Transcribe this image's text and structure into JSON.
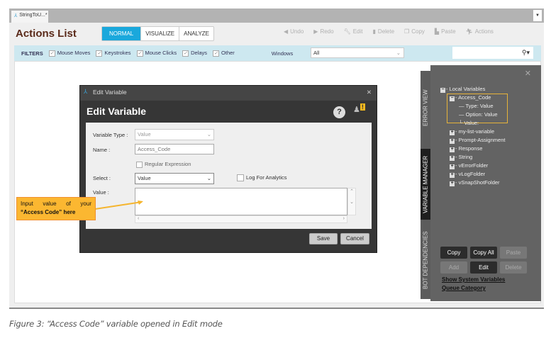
{
  "window": {
    "tab_title": "StringToU...*"
  },
  "header": {
    "title": "Actions List",
    "modes": [
      "NORMAL",
      "VISUALIZE",
      "ANALYZE"
    ],
    "active_mode": "NORMAL",
    "tools": [
      {
        "label": "Undo",
        "icon": "undo-icon"
      },
      {
        "label": "Redo",
        "icon": "redo-icon"
      },
      {
        "label": "Edit",
        "icon": "wrench-icon"
      },
      {
        "label": "Delete",
        "icon": "trash-icon"
      },
      {
        "label": "Copy",
        "icon": "copy-icon"
      },
      {
        "label": "Paste",
        "icon": "paste-icon"
      },
      {
        "label": "Actions",
        "icon": "run-icon"
      }
    ]
  },
  "filters": {
    "label": "FILTERS",
    "items": [
      "Mouse Moves",
      "Keystrokes",
      "Mouse Clicks",
      "Delays",
      "Other"
    ],
    "windows_label": "Windows",
    "windows_value": "All"
  },
  "side_tabs": [
    "ERROR VIEW",
    "VARIABLE MANAGER",
    "BOT DEPENDENCIES"
  ],
  "variables": {
    "root": "Local Variables",
    "selected": "Access_Code",
    "details": [
      "Type: Value",
      "Option: Value",
      "Value:"
    ],
    "others": [
      "my-list-variable",
      "Prompt-Assignment",
      "Response",
      "String",
      "vErrorFolder",
      "vLogFolder",
      "vSnapShotFolder"
    ],
    "buttons": {
      "copy": "Copy",
      "copy_all": "Copy All",
      "paste": "Paste",
      "add": "Add",
      "edit": "Edit",
      "delete": "Delete"
    },
    "links": [
      "Show System Variables",
      "Queue Category"
    ]
  },
  "dialog": {
    "window_title": "Edit Variable",
    "heading": "Edit Variable",
    "variable_type_label": "Variable Type :",
    "variable_type": "Value",
    "name_label": "Name :",
    "name": "Access_Code",
    "regex_label": "Regular Expression",
    "select_label": "Select :",
    "select": "Value",
    "log_label": "Log For Analytics",
    "value_label": "Value :",
    "value": "",
    "save": "Save",
    "cancel": "Cancel"
  },
  "callout": {
    "line1": "Input value of your",
    "line2": "“Access Code” here"
  },
  "caption": "Figure 3: “Access Code” variable opened in Edit mode",
  "colors": {
    "accent": "#1aa8dc",
    "callout": "#fbb731",
    "highlight": "#e6b33a"
  }
}
